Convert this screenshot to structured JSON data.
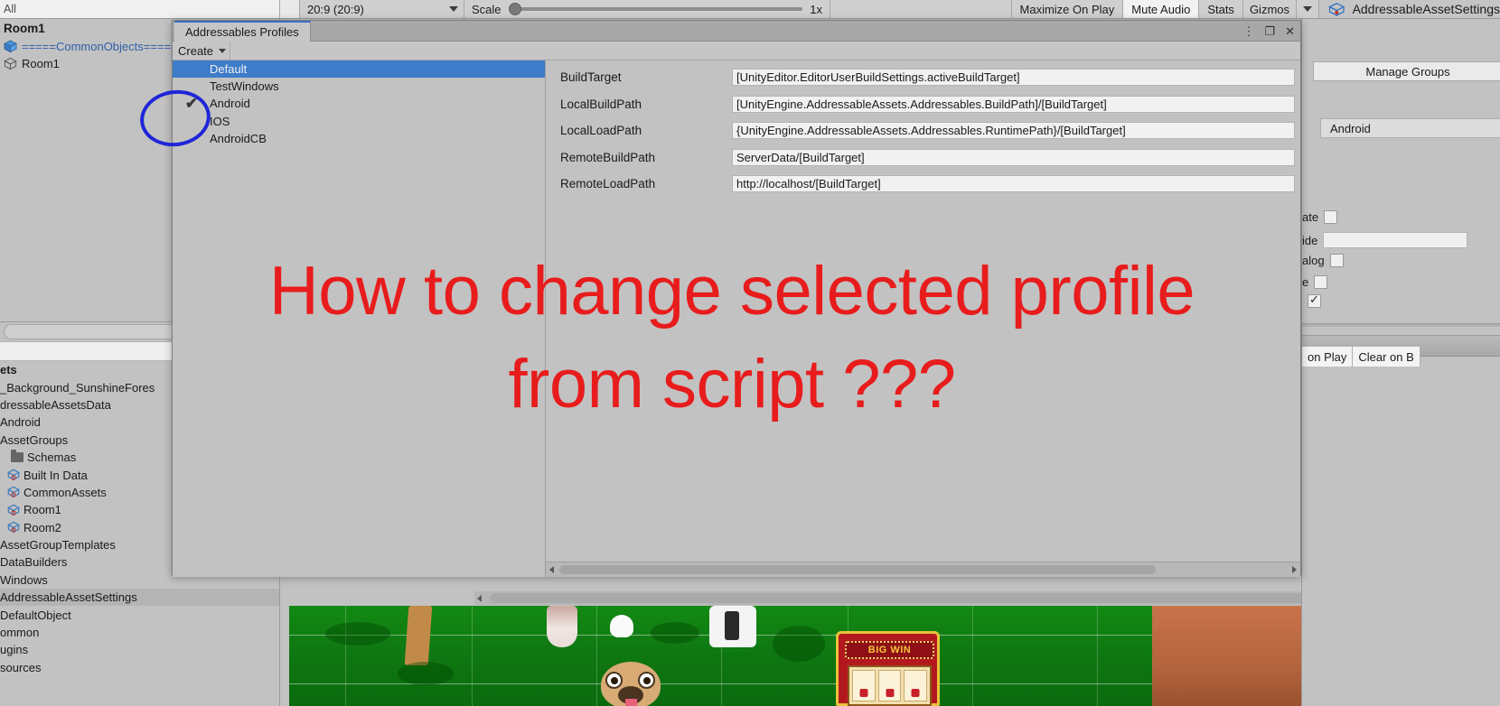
{
  "toolbar": {
    "all_label": "All",
    "aspect_ratio": "20:9 (20:9)",
    "scale_label": "Scale",
    "scale_value": "1x",
    "maximize_on_play": "Maximize On Play",
    "mute_audio": "Mute Audio",
    "stats": "Stats",
    "gizmos": "Gizmos",
    "asset_settings_tab": "AddressableAssetSettings"
  },
  "hierarchy": {
    "title": "Room1",
    "items": [
      {
        "label": "=====CommonObjects=====",
        "style": "blue"
      },
      {
        "label": "Room1",
        "style": "normal"
      }
    ]
  },
  "project": {
    "rows": [
      {
        "label": "ets",
        "indent": 0,
        "bold": true,
        "icon": "none",
        "selected": false
      },
      {
        "label": "_Background_SunshineFores",
        "indent": 0,
        "bold": false,
        "icon": "none",
        "selected": false
      },
      {
        "label": "dressableAssetsData",
        "indent": 0,
        "bold": false,
        "icon": "none",
        "selected": false
      },
      {
        "label": "Android",
        "indent": 0,
        "bold": false,
        "icon": "none",
        "selected": false
      },
      {
        "label": "AssetGroups",
        "indent": 0,
        "bold": false,
        "icon": "none",
        "selected": false
      },
      {
        "label": "Schemas",
        "indent": 12,
        "bold": false,
        "icon": "folder",
        "selected": false
      },
      {
        "label": "Built In Data",
        "indent": 8,
        "bold": false,
        "icon": "asset",
        "selected": false
      },
      {
        "label": "CommonAssets",
        "indent": 8,
        "bold": false,
        "icon": "asset",
        "selected": false
      },
      {
        "label": "Room1",
        "indent": 8,
        "bold": false,
        "icon": "asset",
        "selected": false
      },
      {
        "label": "Room2",
        "indent": 8,
        "bold": false,
        "icon": "asset",
        "selected": false
      },
      {
        "label": "AssetGroupTemplates",
        "indent": 0,
        "bold": false,
        "icon": "none",
        "selected": false
      },
      {
        "label": "DataBuilders",
        "indent": 0,
        "bold": false,
        "icon": "none",
        "selected": false
      },
      {
        "label": "Windows",
        "indent": 0,
        "bold": false,
        "icon": "none",
        "selected": false
      },
      {
        "label": "AddressableAssetSettings",
        "indent": 0,
        "bold": false,
        "icon": "none",
        "selected": true
      },
      {
        "label": "DefaultObject",
        "indent": 0,
        "bold": false,
        "icon": "none",
        "selected": false
      },
      {
        "label": "ommon",
        "indent": 0,
        "bold": false,
        "icon": "none",
        "selected": false
      },
      {
        "label": "ugins",
        "indent": 0,
        "bold": false,
        "icon": "none",
        "selected": false
      },
      {
        "label": "sources",
        "indent": 0,
        "bold": false,
        "icon": "none",
        "selected": false
      }
    ]
  },
  "profiles_window": {
    "tab_label": "Addressables Profiles",
    "window_buttons": {
      "menu": "⋮",
      "maximize": "❐",
      "close": "✕"
    },
    "create_label": "Create",
    "profiles": [
      {
        "name": "Default",
        "active": false,
        "selected": true
      },
      {
        "name": "TestWindows",
        "active": false,
        "selected": false
      },
      {
        "name": "Android",
        "active": true,
        "selected": false
      },
      {
        "name": "IOS",
        "active": false,
        "selected": false
      },
      {
        "name": "AndroidCB",
        "active": false,
        "selected": false
      }
    ],
    "active_marker": "✔",
    "variables": [
      {
        "name": "BuildTarget",
        "value": "[UnityEditor.EditorUserBuildSettings.activeBuildTarget]"
      },
      {
        "name": "LocalBuildPath",
        "value": "[UnityEngine.AddressableAssets.Addressables.BuildPath]/[BuildTarget]"
      },
      {
        "name": "LocalLoadPath",
        "value": "{UnityEngine.AddressableAssets.Addressables.RuntimePath}/[BuildTarget]"
      },
      {
        "name": "RemoteBuildPath",
        "value": "ServerData/[BuildTarget]"
      },
      {
        "name": "RemoteLoadPath",
        "value": "http://localhost/[BuildTarget]"
      }
    ]
  },
  "inspector": {
    "manage_groups": "Manage Groups",
    "active_profile": "Android",
    "fields": [
      {
        "label": "ate",
        "type": "checkbox",
        "checked": false
      },
      {
        "label": "ide",
        "type": "text",
        "value": ""
      },
      {
        "label": "alog",
        "type": "checkbox",
        "checked": false
      },
      {
        "label": "e",
        "type": "checkbox",
        "checked": false
      },
      {
        "label": "",
        "type": "checkbox",
        "checked": true
      }
    ],
    "console_buttons": [
      "on Play",
      "Clear on B"
    ]
  },
  "annotation": {
    "line1": "How to change selected profile",
    "line2": "from script ???",
    "color": "#e81c1c",
    "circle_color": "#1f26d8"
  },
  "gameview": {
    "machine_label": "BIG WIN"
  }
}
